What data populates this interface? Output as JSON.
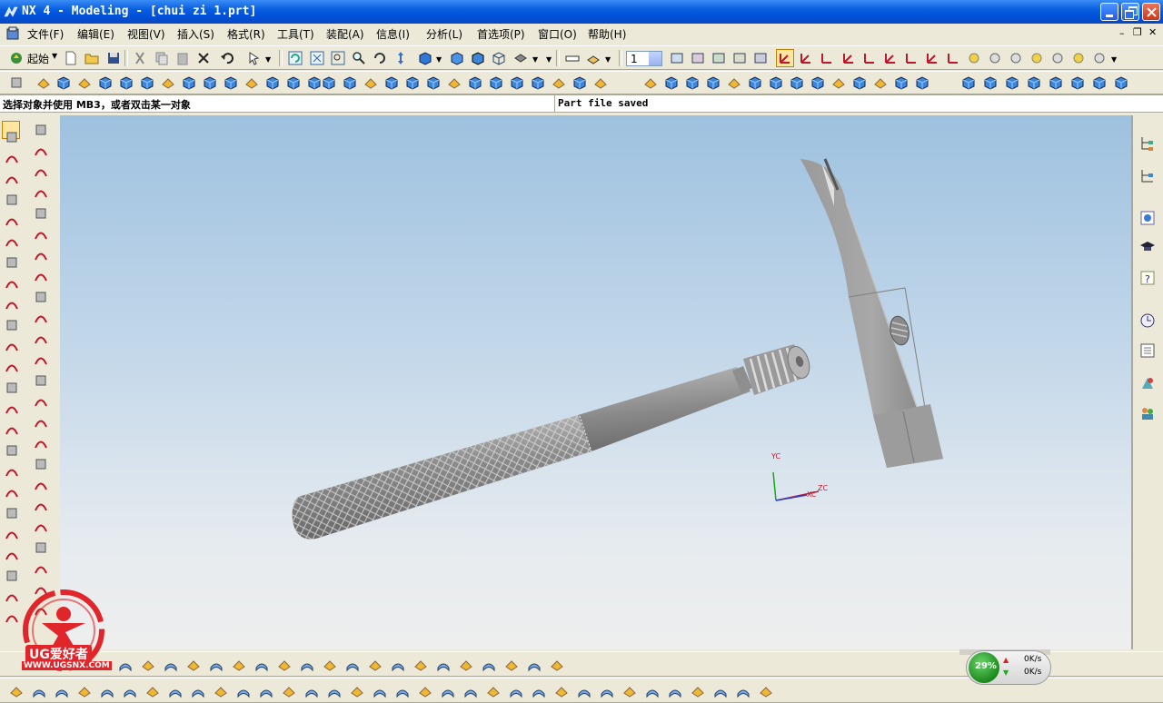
{
  "window": {
    "title": "NX 4 - Modeling - [chui zi 1.prt]"
  },
  "menu": {
    "items": [
      "文件(F)",
      "编辑(E)",
      "视图(V)",
      "插入(S)",
      "格式(R)",
      "工具(T)",
      "装配(A)",
      "信息(I)",
      "分析(L)",
      "首选项(P)",
      "窗口(O)",
      "帮助(H)"
    ]
  },
  "toolbar": {
    "start_label": "起始",
    "layer_value": "1"
  },
  "status": {
    "prompt": "选择对象并使用 MB3，或者双击某一对象",
    "message": "Part file saved"
  },
  "viewport": {
    "triad": {
      "yc": "YC",
      "zc": "ZC",
      "xc": "XC"
    }
  },
  "net_monitor": {
    "percent": "29%",
    "up": "0K/s",
    "down": "0K/s"
  },
  "watermark": {
    "brand": "UG爱好者",
    "url": "WWW.UGSNX.COM"
  },
  "colors": {
    "titlebar": "#0a5fe0",
    "toolbar_bg": "#ece9d8",
    "viewport_top": "#9ec1df",
    "viewport_bottom": "#eeeeee",
    "model_grey": "#a9a9a9",
    "watermark_red": "#e0262a"
  }
}
